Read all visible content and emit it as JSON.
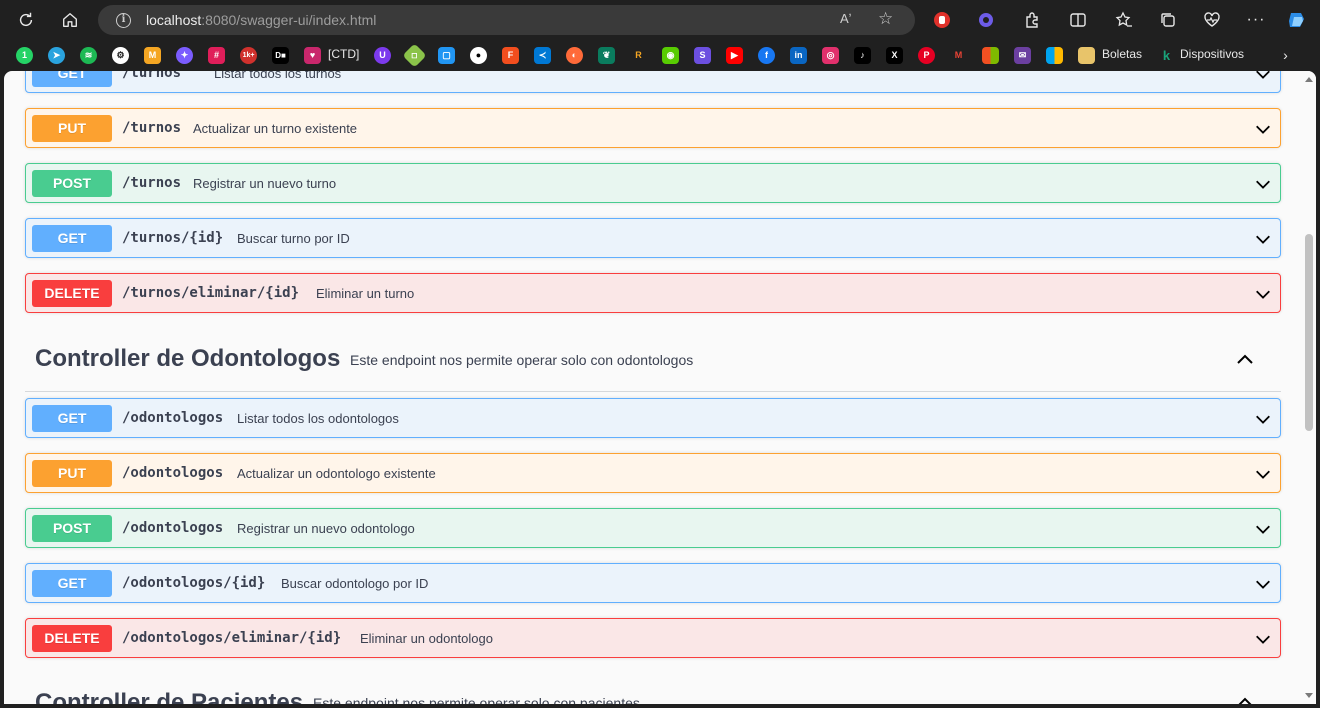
{
  "browser": {
    "url_host": "localhost",
    "url_rest": ":8080/swagger-ui/index.html",
    "read_aloud": "Aʼ",
    "bookmarks": {
      "ctd": "[CTD]",
      "boletas": "Boletas",
      "dispositivos": "Dispositivos"
    }
  },
  "sections": {
    "turnos": {
      "ops": [
        {
          "method": "GET",
          "path": "/turnos",
          "summary": "Listar todos los turnos"
        },
        {
          "method": "PUT",
          "path": "/turnos",
          "summary": "Actualizar un turno existente"
        },
        {
          "method": "POST",
          "path": "/turnos",
          "summary": "Registrar un nuevo turno"
        },
        {
          "method": "GET",
          "path": "/turnos/{id}",
          "summary": "Buscar turno por ID"
        },
        {
          "method": "DELETE",
          "path": "/turnos/eliminar/{id}",
          "summary": "Eliminar un turno"
        }
      ]
    },
    "odontologos": {
      "title": "Controller de Odontologos",
      "description": "Este endpoint nos permite operar solo con odontologos",
      "ops": [
        {
          "method": "GET",
          "path": "/odontologos",
          "summary": "Listar todos los odontologos"
        },
        {
          "method": "PUT",
          "path": "/odontologos",
          "summary": "Actualizar un odontologo existente"
        },
        {
          "method": "POST",
          "path": "/odontologos",
          "summary": "Registrar un nuevo odontologo"
        },
        {
          "method": "GET",
          "path": "/odontologos/{id}",
          "summary": "Buscar odontologo por ID"
        },
        {
          "method": "DELETE",
          "path": "/odontologos/eliminar/{id}",
          "summary": "Eliminar un odontologo"
        }
      ]
    },
    "pacientes": {
      "title": "Controller de Pacientes",
      "description": "Este endpoint nos permite operar solo con pacientes"
    }
  },
  "colors": {
    "get": "#61affe",
    "put": "#fca130",
    "post": "#49cc90",
    "delete": "#f93e3e"
  }
}
